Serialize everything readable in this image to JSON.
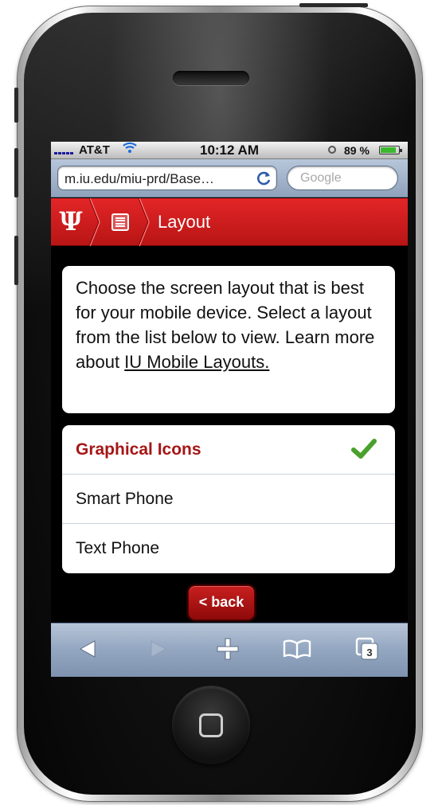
{
  "status_bar": {
    "carrier": "AT&T",
    "time": "10:12 AM",
    "battery": "89 %"
  },
  "browser": {
    "url": "m.iu.edu/miu-prd/Base…",
    "search_placeholder": "Google"
  },
  "header": {
    "logo": "Ψ",
    "title": "Layout"
  },
  "intro": {
    "text": "Choose the screen layout that is best for your mobile device. Select a layout from the list below to view. Learn more about ",
    "link_text": "IU Mobile Layouts."
  },
  "layouts": [
    {
      "label": "Graphical Icons",
      "selected": true
    },
    {
      "label": "Smart Phone",
      "selected": false
    },
    {
      "label": "Text Phone",
      "selected": false
    }
  ],
  "back_button": "< back",
  "toolbar": {
    "tab_count": "3",
    "icons": [
      "back-arrow-icon",
      "forward-arrow-icon",
      "add-icon",
      "bookmarks-icon",
      "pages-icon"
    ]
  },
  "colors": {
    "iu_red": "#c81e1e",
    "selected_text": "#a51616",
    "check_green": "#4aa02c"
  }
}
